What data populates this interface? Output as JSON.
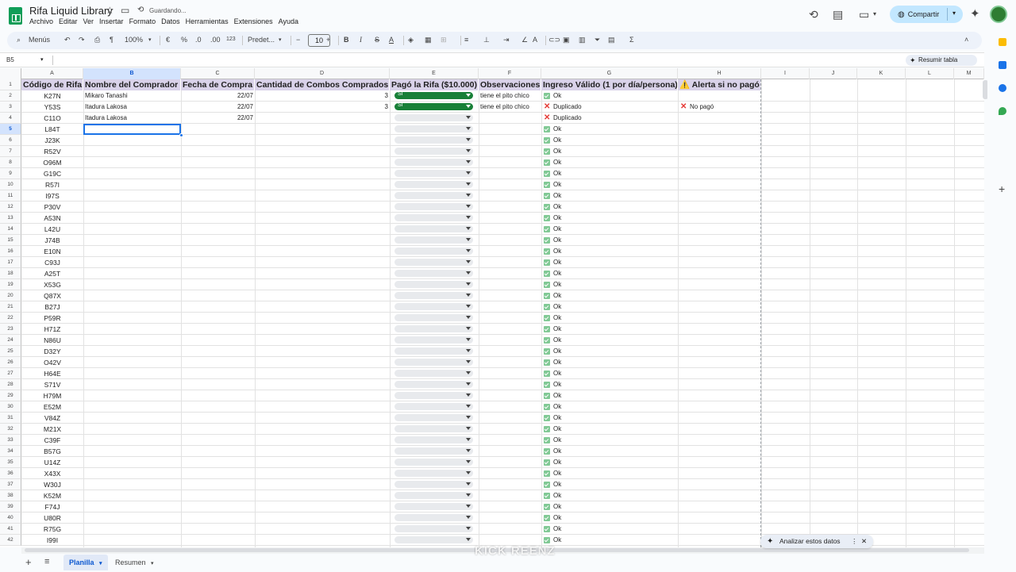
{
  "app": {
    "doc_title": "Rifa Liquid Library",
    "saving_status": "Guardando...",
    "menu": [
      "Archivo",
      "Editar",
      "Ver",
      "Insertar",
      "Formato",
      "Datos",
      "Herramientas",
      "Extensiones",
      "Ayuda"
    ],
    "share_label": "Compartir"
  },
  "toolbar": {
    "search_label": "Menús",
    "zoom": "100%",
    "currency": "€",
    "percent": "%",
    "dec_less": ".0",
    "dec_more": ".00",
    "num_format": "123",
    "font": "Predet...",
    "font_size": "10",
    "bold": "B",
    "italic": "I",
    "strike": "S",
    "underline_a": "A",
    "sigma": "Σ"
  },
  "formula_bar": {
    "name_box": "B5",
    "resumir_label": "Resumir tabla"
  },
  "columns": [
    "A",
    "B",
    "C",
    "D",
    "E",
    "F",
    "G",
    "H",
    "I",
    "J",
    "K",
    "L",
    "M"
  ],
  "selected_column": "B",
  "selected_row": 5,
  "headers": [
    "Código de Rifa",
    "Nombre del Comprador",
    "Fecha de Compra",
    "Cantidad de Combos Comprados",
    "Pagó la Rifa ($10.000)",
    "Observaciones",
    "Ingreso Válido (1 por día/persona)",
    "⚠️ Alerta si no pagó"
  ],
  "rows": [
    {
      "n": "2",
      "code": "K27N",
      "name": "Mikaro Tanashi",
      "date": "22/07",
      "qty": "3",
      "paid": "Sí",
      "obs": "tiene el pito chico",
      "status": "ok",
      "valid": "Ok",
      "alert": ""
    },
    {
      "n": "3",
      "code": "Y53S",
      "name": "Itadura Lakosa",
      "date": "22/07",
      "qty": "3",
      "paid": "Sí",
      "obs": "tiene el pito chico",
      "status": "dup",
      "valid": "Duplicado",
      "alert": "No pagó"
    },
    {
      "n": "4",
      "code": "C11O",
      "name": "Itadura Lakosa",
      "date": "22/07",
      "qty": "",
      "paid": "",
      "obs": "",
      "status": "dup",
      "valid": "Duplicado",
      "alert": ""
    },
    {
      "n": "5",
      "code": "L84T",
      "valid": "Ok",
      "status": "ok"
    },
    {
      "n": "6",
      "code": "J23K",
      "valid": "Ok",
      "status": "ok"
    },
    {
      "n": "7",
      "code": "R52V",
      "valid": "Ok",
      "status": "ok"
    },
    {
      "n": "8",
      "code": "O96M",
      "valid": "Ok",
      "status": "ok"
    },
    {
      "n": "9",
      "code": "G19C",
      "valid": "Ok",
      "status": "ok"
    },
    {
      "n": "10",
      "code": "R57I",
      "valid": "Ok",
      "status": "ok"
    },
    {
      "n": "11",
      "code": "I97S",
      "valid": "Ok",
      "status": "ok"
    },
    {
      "n": "12",
      "code": "P30V",
      "valid": "Ok",
      "status": "ok"
    },
    {
      "n": "13",
      "code": "A53N",
      "valid": "Ok",
      "status": "ok"
    },
    {
      "n": "14",
      "code": "L42U",
      "valid": "Ok",
      "status": "ok"
    },
    {
      "n": "15",
      "code": "J74B",
      "valid": "Ok",
      "status": "ok"
    },
    {
      "n": "16",
      "code": "E10N",
      "valid": "Ok",
      "status": "ok"
    },
    {
      "n": "17",
      "code": "C93J",
      "valid": "Ok",
      "status": "ok"
    },
    {
      "n": "18",
      "code": "A25T",
      "valid": "Ok",
      "status": "ok"
    },
    {
      "n": "19",
      "code": "X53G",
      "valid": "Ok",
      "status": "ok"
    },
    {
      "n": "20",
      "code": "Q87X",
      "valid": "Ok",
      "status": "ok"
    },
    {
      "n": "21",
      "code": "B27J",
      "valid": "Ok",
      "status": "ok"
    },
    {
      "n": "22",
      "code": "P59R",
      "valid": "Ok",
      "status": "ok"
    },
    {
      "n": "23",
      "code": "H71Z",
      "valid": "Ok",
      "status": "ok"
    },
    {
      "n": "24",
      "code": "N86U",
      "valid": "Ok",
      "status": "ok"
    },
    {
      "n": "25",
      "code": "D32Y",
      "valid": "Ok",
      "status": "ok"
    },
    {
      "n": "26",
      "code": "O42V",
      "valid": "Ok",
      "status": "ok"
    },
    {
      "n": "27",
      "code": "H64E",
      "valid": "Ok",
      "status": "ok"
    },
    {
      "n": "28",
      "code": "S71V",
      "valid": "Ok",
      "status": "ok"
    },
    {
      "n": "29",
      "code": "H79M",
      "valid": "Ok",
      "status": "ok"
    },
    {
      "n": "30",
      "code": "E52M",
      "valid": "Ok",
      "status": "ok"
    },
    {
      "n": "31",
      "code": "V84Z",
      "valid": "Ok",
      "status": "ok"
    },
    {
      "n": "32",
      "code": "M21X",
      "valid": "Ok",
      "status": "ok"
    },
    {
      "n": "33",
      "code": "C39F",
      "valid": "Ok",
      "status": "ok"
    },
    {
      "n": "34",
      "code": "B57G",
      "valid": "Ok",
      "status": "ok"
    },
    {
      "n": "35",
      "code": "U14Z",
      "valid": "Ok",
      "status": "ok"
    },
    {
      "n": "36",
      "code": "X43X",
      "valid": "Ok",
      "status": "ok"
    },
    {
      "n": "37",
      "code": "W30J",
      "valid": "Ok",
      "status": "ok"
    },
    {
      "n": "38",
      "code": "K52M",
      "valid": "Ok",
      "status": "ok"
    },
    {
      "n": "39",
      "code": "F74J",
      "valid": "Ok",
      "status": "ok"
    },
    {
      "n": "40",
      "code": "U80R",
      "valid": "Ok",
      "status": "ok"
    },
    {
      "n": "41",
      "code": "R75G",
      "valid": "Ok",
      "status": "ok"
    },
    {
      "n": "42",
      "code": "I99I",
      "valid": "Ok",
      "status": "ok"
    }
  ],
  "sheet_tabs": {
    "active": "Planilla",
    "other": "Resumen"
  },
  "analyze_label": "Analizar estos datos",
  "watermark": "KICK REENZ",
  "colors": {
    "accent": "#0b57d0",
    "header_bg": "#d9d2e9",
    "paid_green": "#188038",
    "ok_green": "#81c995",
    "error_red": "#e53935",
    "share_bg": "#c2e7ff"
  }
}
